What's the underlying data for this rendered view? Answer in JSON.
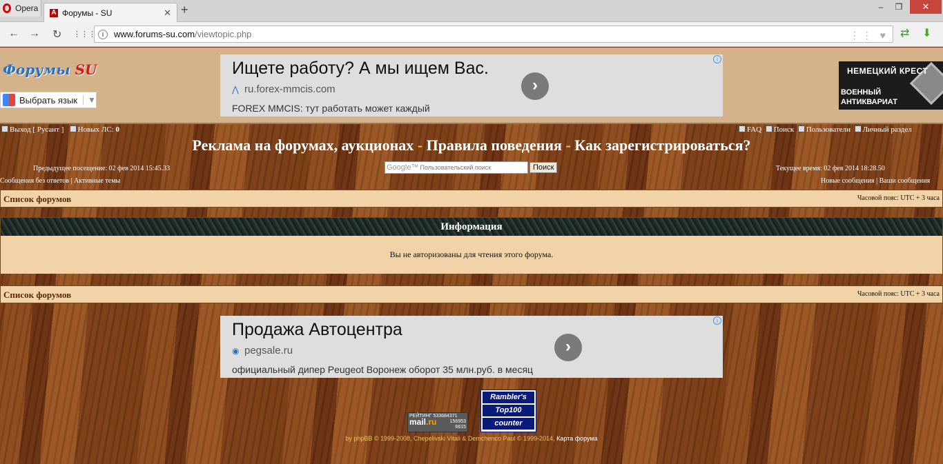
{
  "browser": {
    "app_name": "Opera",
    "tab_title": "Форумы - SU",
    "tab_icon": "А",
    "url_domain": "www.forums-su.com",
    "url_path": "/viewtopic.php",
    "close_glyph": "✕",
    "new_tab_glyph": "+",
    "min_glyph": "–",
    "max_glyph": "❐",
    "back_glyph": "←",
    "forward_glyph": "→",
    "reload_glyph": "↻",
    "speeddial_glyph": "⋮⋮⋮",
    "url_right_glyphs": "⋮⋮ ♥"
  },
  "header": {
    "logo_main": "Форумы",
    "logo_su": "SU",
    "lang_button": "Выбрать язык",
    "lang_arrow": "▼"
  },
  "ad_top": {
    "title": "Ищете работу? А мы ищем Вас.",
    "url": "ru.forex-mmcis.com",
    "desc": "FOREX MMCIS: тут работать может каждый",
    "arrow": "›",
    "info": "i"
  },
  "banner_right": {
    "line1": "НЕМЕЦКИЙ КРЕСТ",
    "line2": "ВОЕННЫЙ",
    "line3": "АНТИКВАРИАТ"
  },
  "toplinks": {
    "logout": "Выход [ Русант ]",
    "new_pm_label": "Новых ЛС:",
    "new_pm_count": "0",
    "faq": "FAQ",
    "search": "Поиск",
    "users": "Пользователи",
    "personal": "Личный раздел"
  },
  "title_bar": {
    "part1": "Реклама на форумах, аукционах",
    "sep": " - ",
    "part2": "Правила поведения",
    "part3": "Как зарегистрироваться?"
  },
  "visits": {
    "previous": "Предыдущее посещение: 02 фев 2014 15:45.33",
    "current": "Текущее время: 02 фев 2014 18:28.50"
  },
  "search_box": {
    "google": "Google™",
    "placeholder": "Пользовательский поиск",
    "button": "Поиск"
  },
  "links_left": {
    "unanswered": "Сообщения без ответов",
    "active": "Активные темы",
    "sep": " | "
  },
  "links_right": {
    "new_posts": "Новые сообщения",
    "your_posts": "Ваши сообщения",
    "sep": " | "
  },
  "nav": {
    "breadcrumb": "Список форумов",
    "timezone": "Часовой пояс: UTC + 3 часа"
  },
  "info": {
    "heading": "Информация",
    "message": "Вы не авторизованы для чтения этого форума."
  },
  "ad_bottom": {
    "title": "Продажа Автоцентра",
    "url": "pegsale.ru",
    "desc": "официальный дипер Peugeot Воронеж оборот 35 млн.руб. в месяц",
    "arrow": "›",
    "info": "i"
  },
  "counters": {
    "mail_rating": "РЕЙТИНГ 533684371",
    "mail_n1": "156953",
    "mail_n2": "6615",
    "mail_brand_a": "mail",
    "mail_brand_b": ".ru",
    "rambler1": "Rambler's",
    "rambler2": "Top100",
    "rambler3": "counter"
  },
  "footer": {
    "powered": "by phpBB © 1999-2008, Chepelivski Vitali & Demchenco Paul © 1999-2014,",
    "map": "Карта форума"
  },
  "colors": {
    "header_band": "#d4b28a",
    "strip": "#f1d3a7",
    "info_head": "#1e2a28",
    "footer_text": "#f0c060"
  }
}
